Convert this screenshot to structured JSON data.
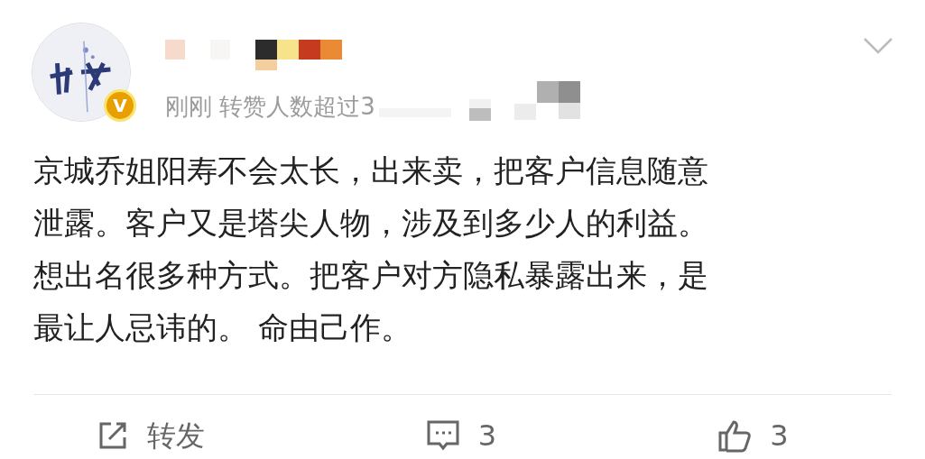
{
  "post": {
    "author": {
      "verified_badge": "V"
    },
    "meta": "刚刚 转赞人数超过3",
    "body": [
      "京城乔姐阳寿不会太长，出来卖，把客户信息随意",
      "泄露。客户又是塔尖人物，涉及到多少人的利益。",
      "想出名很多种方式。把客户对方隐私暴露出来，是",
      "最让人忌讳的。 命由己作。"
    ]
  },
  "actions": [
    {
      "kind": "repost",
      "label": "转发"
    },
    {
      "kind": "comment",
      "label": "3"
    },
    {
      "kind": "like",
      "label": "3"
    }
  ]
}
